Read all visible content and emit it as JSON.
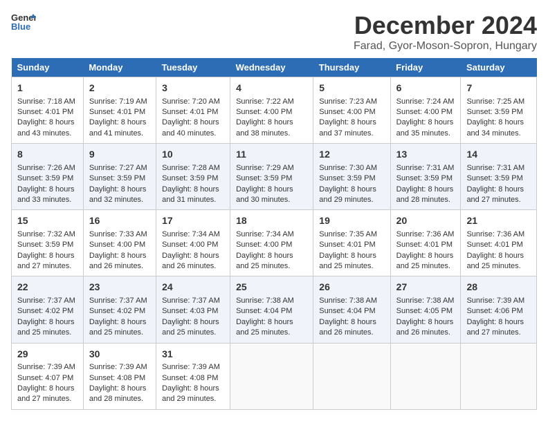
{
  "header": {
    "logo_line1": "General",
    "logo_line2": "Blue",
    "title": "December 2024",
    "subtitle": "Farad, Gyor-Moson-Sopron, Hungary"
  },
  "calendar": {
    "days_of_week": [
      "Sunday",
      "Monday",
      "Tuesday",
      "Wednesday",
      "Thursday",
      "Friday",
      "Saturday"
    ],
    "weeks": [
      [
        {
          "day": "1",
          "sunrise": "Sunrise: 7:18 AM",
          "sunset": "Sunset: 4:01 PM",
          "daylight": "Daylight: 8 hours and 43 minutes."
        },
        {
          "day": "2",
          "sunrise": "Sunrise: 7:19 AM",
          "sunset": "Sunset: 4:01 PM",
          "daylight": "Daylight: 8 hours and 41 minutes."
        },
        {
          "day": "3",
          "sunrise": "Sunrise: 7:20 AM",
          "sunset": "Sunset: 4:01 PM",
          "daylight": "Daylight: 8 hours and 40 minutes."
        },
        {
          "day": "4",
          "sunrise": "Sunrise: 7:22 AM",
          "sunset": "Sunset: 4:00 PM",
          "daylight": "Daylight: 8 hours and 38 minutes."
        },
        {
          "day": "5",
          "sunrise": "Sunrise: 7:23 AM",
          "sunset": "Sunset: 4:00 PM",
          "daylight": "Daylight: 8 hours and 37 minutes."
        },
        {
          "day": "6",
          "sunrise": "Sunrise: 7:24 AM",
          "sunset": "Sunset: 4:00 PM",
          "daylight": "Daylight: 8 hours and 35 minutes."
        },
        {
          "day": "7",
          "sunrise": "Sunrise: 7:25 AM",
          "sunset": "Sunset: 3:59 PM",
          "daylight": "Daylight: 8 hours and 34 minutes."
        }
      ],
      [
        {
          "day": "8",
          "sunrise": "Sunrise: 7:26 AM",
          "sunset": "Sunset: 3:59 PM",
          "daylight": "Daylight: 8 hours and 33 minutes."
        },
        {
          "day": "9",
          "sunrise": "Sunrise: 7:27 AM",
          "sunset": "Sunset: 3:59 PM",
          "daylight": "Daylight: 8 hours and 32 minutes."
        },
        {
          "day": "10",
          "sunrise": "Sunrise: 7:28 AM",
          "sunset": "Sunset: 3:59 PM",
          "daylight": "Daylight: 8 hours and 31 minutes."
        },
        {
          "day": "11",
          "sunrise": "Sunrise: 7:29 AM",
          "sunset": "Sunset: 3:59 PM",
          "daylight": "Daylight: 8 hours and 30 minutes."
        },
        {
          "day": "12",
          "sunrise": "Sunrise: 7:30 AM",
          "sunset": "Sunset: 3:59 PM",
          "daylight": "Daylight: 8 hours and 29 minutes."
        },
        {
          "day": "13",
          "sunrise": "Sunrise: 7:31 AM",
          "sunset": "Sunset: 3:59 PM",
          "daylight": "Daylight: 8 hours and 28 minutes."
        },
        {
          "day": "14",
          "sunrise": "Sunrise: 7:31 AM",
          "sunset": "Sunset: 3:59 PM",
          "daylight": "Daylight: 8 hours and 27 minutes."
        }
      ],
      [
        {
          "day": "15",
          "sunrise": "Sunrise: 7:32 AM",
          "sunset": "Sunset: 3:59 PM",
          "daylight": "Daylight: 8 hours and 27 minutes."
        },
        {
          "day": "16",
          "sunrise": "Sunrise: 7:33 AM",
          "sunset": "Sunset: 4:00 PM",
          "daylight": "Daylight: 8 hours and 26 minutes."
        },
        {
          "day": "17",
          "sunrise": "Sunrise: 7:34 AM",
          "sunset": "Sunset: 4:00 PM",
          "daylight": "Daylight: 8 hours and 26 minutes."
        },
        {
          "day": "18",
          "sunrise": "Sunrise: 7:34 AM",
          "sunset": "Sunset: 4:00 PM",
          "daylight": "Daylight: 8 hours and 25 minutes."
        },
        {
          "day": "19",
          "sunrise": "Sunrise: 7:35 AM",
          "sunset": "Sunset: 4:01 PM",
          "daylight": "Daylight: 8 hours and 25 minutes."
        },
        {
          "day": "20",
          "sunrise": "Sunrise: 7:36 AM",
          "sunset": "Sunset: 4:01 PM",
          "daylight": "Daylight: 8 hours and 25 minutes."
        },
        {
          "day": "21",
          "sunrise": "Sunrise: 7:36 AM",
          "sunset": "Sunset: 4:01 PM",
          "daylight": "Daylight: 8 hours and 25 minutes."
        }
      ],
      [
        {
          "day": "22",
          "sunrise": "Sunrise: 7:37 AM",
          "sunset": "Sunset: 4:02 PM",
          "daylight": "Daylight: 8 hours and 25 minutes."
        },
        {
          "day": "23",
          "sunrise": "Sunrise: 7:37 AM",
          "sunset": "Sunset: 4:02 PM",
          "daylight": "Daylight: 8 hours and 25 minutes."
        },
        {
          "day": "24",
          "sunrise": "Sunrise: 7:37 AM",
          "sunset": "Sunset: 4:03 PM",
          "daylight": "Daylight: 8 hours and 25 minutes."
        },
        {
          "day": "25",
          "sunrise": "Sunrise: 7:38 AM",
          "sunset": "Sunset: 4:04 PM",
          "daylight": "Daylight: 8 hours and 25 minutes."
        },
        {
          "day": "26",
          "sunrise": "Sunrise: 7:38 AM",
          "sunset": "Sunset: 4:04 PM",
          "daylight": "Daylight: 8 hours and 26 minutes."
        },
        {
          "day": "27",
          "sunrise": "Sunrise: 7:38 AM",
          "sunset": "Sunset: 4:05 PM",
          "daylight": "Daylight: 8 hours and 26 minutes."
        },
        {
          "day": "28",
          "sunrise": "Sunrise: 7:39 AM",
          "sunset": "Sunset: 4:06 PM",
          "daylight": "Daylight: 8 hours and 27 minutes."
        }
      ],
      [
        {
          "day": "29",
          "sunrise": "Sunrise: 7:39 AM",
          "sunset": "Sunset: 4:07 PM",
          "daylight": "Daylight: 8 hours and 27 minutes."
        },
        {
          "day": "30",
          "sunrise": "Sunrise: 7:39 AM",
          "sunset": "Sunset: 4:08 PM",
          "daylight": "Daylight: 8 hours and 28 minutes."
        },
        {
          "day": "31",
          "sunrise": "Sunrise: 7:39 AM",
          "sunset": "Sunset: 4:08 PM",
          "daylight": "Daylight: 8 hours and 29 minutes."
        },
        null,
        null,
        null,
        null
      ]
    ]
  }
}
